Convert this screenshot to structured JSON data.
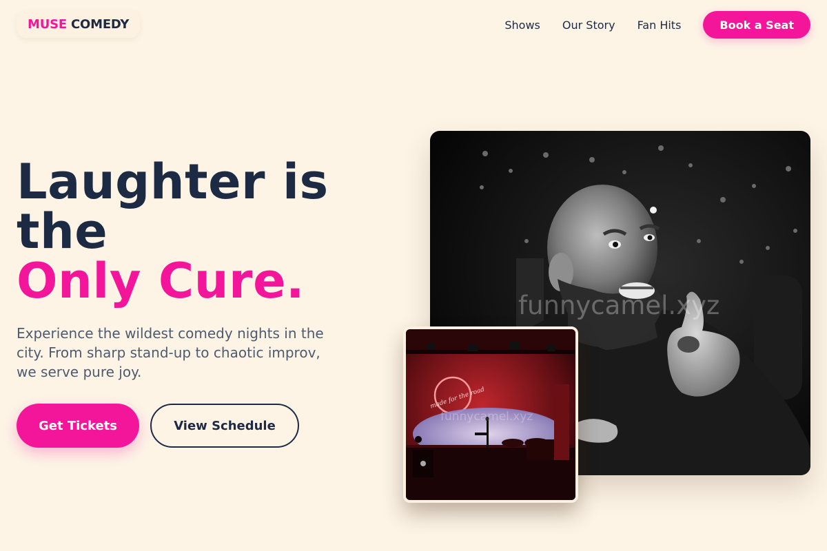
{
  "brand": {
    "first": "MUSE",
    "second": "COMEDY"
  },
  "nav": {
    "links": [
      "Shows",
      "Our Story",
      "Fan Hits"
    ],
    "cta": "Book a Seat"
  },
  "hero": {
    "headline_line1": "Laughter is",
    "headline_line2": "the",
    "headline_accent": "Only Cure.",
    "subtext": "Experience the wildest comedy nights in the city. From sharp stand-up to chaotic improv, we serve pure joy.",
    "primary_cta": "Get Tickets",
    "secondary_cta": "View Schedule"
  },
  "images": {
    "main_watermark": "funnycamel.xyz",
    "small_watermark": "funnycamel.xyz",
    "small_neon_text": "made for the road"
  },
  "colors": {
    "accent": "#f4169a",
    "ink": "#1c2a44",
    "background": "#fdf4e6",
    "muted": "#4e5a6e"
  }
}
